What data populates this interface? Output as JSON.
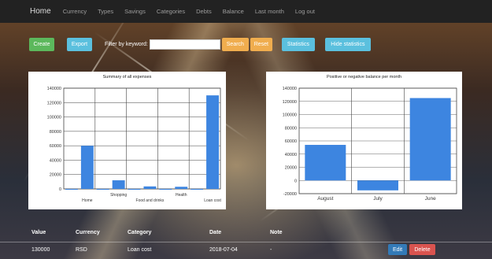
{
  "nav": {
    "brand": "Home",
    "links": [
      "Currency",
      "Types",
      "Savings",
      "Categories",
      "Debts",
      "Balance",
      "Last month",
      "Log out"
    ]
  },
  "toolbar": {
    "create": "Create",
    "export": "Export",
    "filter_label": "Filter by keyword:",
    "filter_value": "",
    "search": "Search",
    "reset": "Reset",
    "statistics": "Statistics",
    "hide_statistics": "Hide statistics"
  },
  "chart_data": [
    {
      "type": "bar",
      "title": "Summary of all expenses",
      "categories": [
        "",
        "Home",
        "",
        "Shopping",
        "",
        "Food and drinks",
        "",
        "Health",
        "",
        "Loan cost"
      ],
      "values": [
        0,
        60000,
        0,
        12000,
        0,
        3500,
        0,
        3000,
        0,
        130000
      ],
      "ylim": [
        0,
        140000
      ],
      "yticks": [
        0,
        20000,
        40000,
        60000,
        80000,
        100000,
        120000,
        140000
      ],
      "grid": true,
      "bar_color": "#3d85e0"
    },
    {
      "type": "bar",
      "title": "Positive or negative balance per month",
      "categories": [
        "August",
        "July",
        "June"
      ],
      "values": [
        54000,
        -15000,
        125000
      ],
      "ylim": [
        -20000,
        140000
      ],
      "yticks": [
        -20000,
        0,
        20000,
        40000,
        60000,
        80000,
        100000,
        120000,
        140000
      ],
      "grid": true,
      "bar_color": "#3d85e0"
    }
  ],
  "table": {
    "headers": [
      "Value",
      "Currency",
      "Category",
      "Date",
      "Note"
    ],
    "rows": [
      {
        "value": "130000",
        "currency": "RSD",
        "category": "Loan cost",
        "date": "2018-07-04",
        "note": "-"
      }
    ],
    "edit": "Edit",
    "delete": "Delete"
  }
}
